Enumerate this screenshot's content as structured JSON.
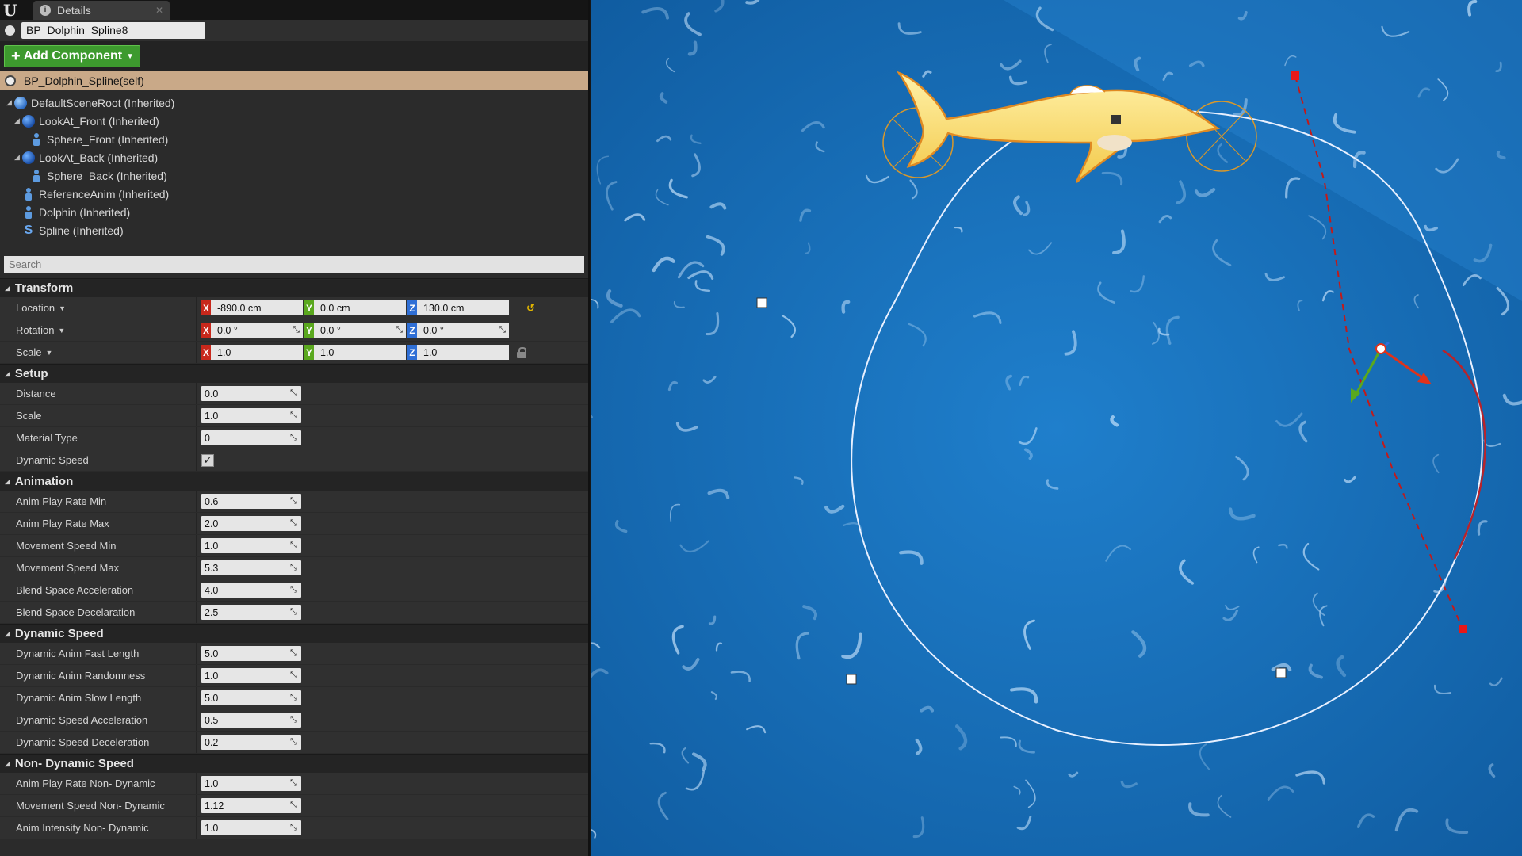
{
  "tab": {
    "title": "Details"
  },
  "actor_name": "BP_Dolphin_Spline8",
  "add_component_label": "Add Component",
  "self_label": "BP_Dolphin_Spline(self)",
  "components": [
    {
      "label": "DefaultSceneRoot (Inherited)",
      "icon": "scene-root-icon"
    },
    {
      "label": "LookAt_Front (Inherited)",
      "icon": "sphere-icon"
    },
    {
      "label": "Sphere_Front (Inherited)",
      "icon": "person-icon"
    },
    {
      "label": "LookAt_Back (Inherited)",
      "icon": "sphere-icon"
    },
    {
      "label": "Sphere_Back (Inherited)",
      "icon": "person-icon"
    },
    {
      "label": "ReferenceAnim (Inherited)",
      "icon": "person-icon"
    },
    {
      "label": "Dolphin (Inherited)",
      "icon": "person-icon"
    },
    {
      "label": "Spline (Inherited)",
      "icon": "spline-icon"
    }
  ],
  "search": {
    "placeholder": "Search"
  },
  "transform": {
    "title": "Transform",
    "axis_labels": {
      "x": "X",
      "y": "Y",
      "z": "Z"
    },
    "location": {
      "label": "Location",
      "x": "-890.0 cm",
      "y": "0.0 cm",
      "z": "130.0 cm"
    },
    "rotation": {
      "label": "Rotation",
      "x": "0.0 °",
      "y": "0.0 °",
      "z": "0.0 °"
    },
    "scale": {
      "label": "Scale",
      "x": "1.0",
      "y": "1.0",
      "z": "1.0"
    }
  },
  "setup": {
    "title": "Setup",
    "distance": {
      "label": "Distance",
      "value": "0.0"
    },
    "scale": {
      "label": "Scale",
      "value": "1.0"
    },
    "material_type": {
      "label": "Material Type",
      "value": "0"
    },
    "dynamic_speed": {
      "label": "Dynamic Speed",
      "checked": true,
      "check_glyph": "✓"
    }
  },
  "animation": {
    "title": "Animation",
    "rows": [
      {
        "label": "Anim Play Rate Min",
        "value": "0.6"
      },
      {
        "label": "Anim Play Rate Max",
        "value": "2.0"
      },
      {
        "label": "Movement Speed Min",
        "value": "1.0"
      },
      {
        "label": "Movement Speed Max",
        "value": "5.3"
      },
      {
        "label": "Blend Space Acceleration",
        "value": "4.0"
      },
      {
        "label": "Blend Space Decelaration",
        "value": "2.5"
      }
    ]
  },
  "dynamic_speed": {
    "title": "Dynamic Speed",
    "rows": [
      {
        "label": "Dynamic Anim Fast Length",
        "value": "5.0"
      },
      {
        "label": "Dynamic Anim Randomness",
        "value": "1.0"
      },
      {
        "label": "Dynamic Anim Slow Length",
        "value": "5.0"
      },
      {
        "label": "Dynamic Speed Acceleration",
        "value": "0.5"
      },
      {
        "label": "Dynamic Speed Deceleration",
        "value": "0.2"
      }
    ]
  },
  "non_dynamic_speed": {
    "title": "Non- Dynamic Speed",
    "rows": [
      {
        "label": "Anim Play Rate Non- Dynamic",
        "value": "1.0"
      },
      {
        "label": "Movement Speed Non- Dynamic",
        "value": "1.12"
      },
      {
        "label": "Anim Intensity Non- Dynamic",
        "value": "1.0"
      }
    ]
  },
  "colors": {
    "add_button": "#3d9a2e",
    "self_highlight": "#c9a988",
    "water": "#1a6fb5",
    "dolphin": "#f7dc6f",
    "spline": "#e8f0ff",
    "spline_selected": "#b8232b"
  }
}
